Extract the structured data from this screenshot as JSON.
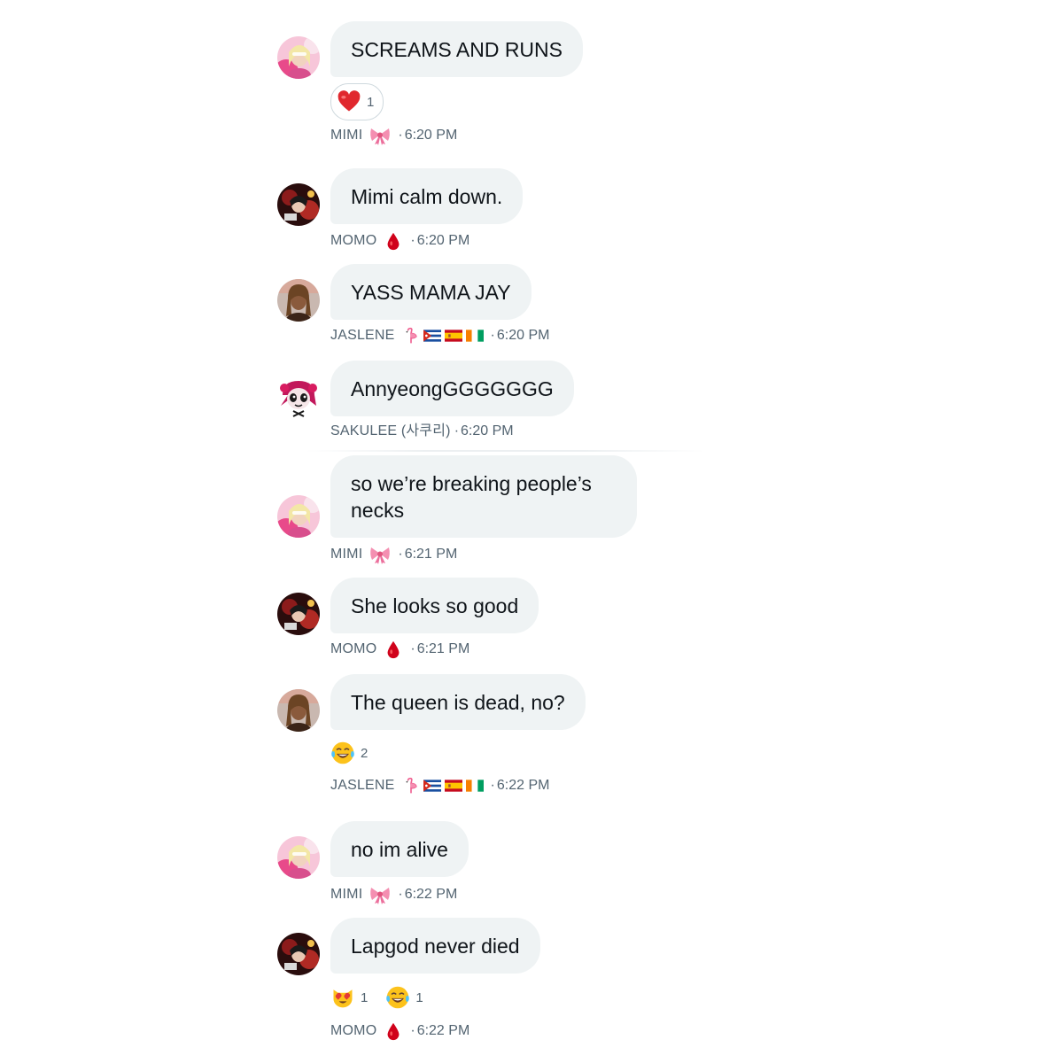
{
  "messages": [
    {
      "sender": "MIMI",
      "sender_emoji": "ribbon-icon",
      "avatar": "mimi-avatar",
      "text": "SCREAMS AND RUNS",
      "time": "6:20 PM",
      "reactions": [
        {
          "emoji": "red-heart-icon",
          "count": "1"
        }
      ]
    },
    {
      "sender": "MOMO",
      "sender_emoji": "drop-of-blood-icon",
      "avatar": "momo-avatar",
      "text": "Mimi calm down.",
      "time": "6:20 PM"
    },
    {
      "sender": "JASLENE",
      "sender_emoji": "flamingo-and-flags-icons",
      "avatar": "jaslene-avatar",
      "text": "YASS MAMA JAY",
      "time": "6:20 PM"
    },
    {
      "sender": "SAKULEE (사쿠리)",
      "avatar": "sakulee-avatar",
      "text": "AnnyeongGGGGGGG",
      "time": "6:20 PM"
    },
    {
      "sender": "MIMI",
      "sender_emoji": "ribbon-icon",
      "avatar": "mimi-avatar",
      "text": "so we’re breaking people’s necks",
      "time": "6:21 PM"
    },
    {
      "sender": "MOMO",
      "sender_emoji": "drop-of-blood-icon",
      "avatar": "momo-avatar",
      "text": "She looks so good",
      "time": "6:21 PM"
    },
    {
      "sender": "JASLENE",
      "sender_emoji": "flamingo-and-flags-icons",
      "avatar": "jaslene-avatar",
      "text": "The queen is dead, no?",
      "time": "6:22 PM",
      "reactions": [
        {
          "emoji": "tears-of-joy-icon",
          "count": "2"
        }
      ]
    },
    {
      "sender": "MIMI",
      "sender_emoji": "ribbon-icon",
      "avatar": "mimi-avatar",
      "text": "no im alive",
      "time": "6:22 PM"
    },
    {
      "sender": "MOMO",
      "sender_emoji": "drop-of-blood-icon",
      "avatar": "momo-avatar",
      "text": "Lapgod never died",
      "time": "6:22 PM",
      "reactions": [
        {
          "emoji": "heart-eyes-cat-icon",
          "count": "1"
        },
        {
          "emoji": "tears-of-joy-icon",
          "count": "1"
        }
      ]
    }
  ],
  "separator": "·",
  "colors": {
    "bubble": "#eff3f4",
    "text": "#0f1419",
    "meta": "#536471"
  }
}
